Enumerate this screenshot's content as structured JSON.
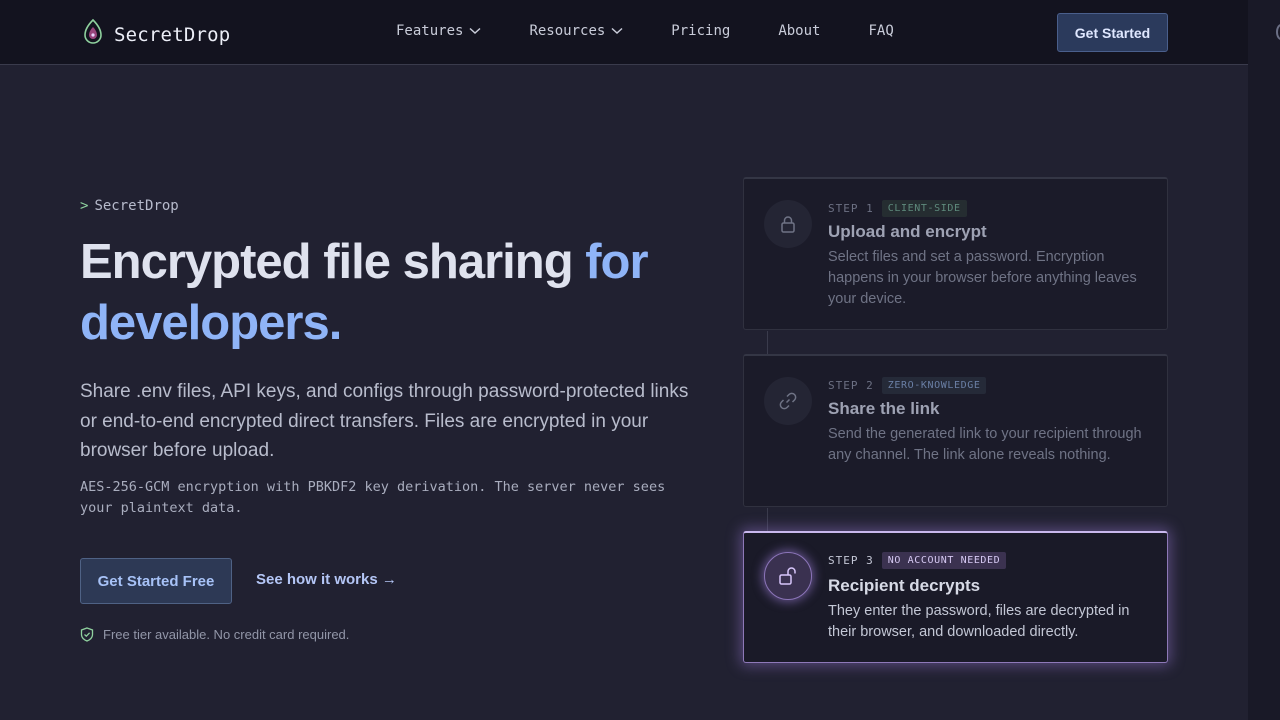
{
  "header": {
    "brand": "SecretDrop",
    "nav": [
      {
        "label": "Features",
        "has_dropdown": true
      },
      {
        "label": "Resources",
        "has_dropdown": true
      },
      {
        "label": "Pricing",
        "has_dropdown": false
      },
      {
        "label": "About",
        "has_dropdown": false
      },
      {
        "label": "FAQ",
        "has_dropdown": false
      }
    ],
    "cta": "Get Started"
  },
  "hero": {
    "eyebrow_prompt": ">",
    "eyebrow": "SecretDrop",
    "headline_main": "Encrypted file sharing ",
    "headline_accent": "for developers.",
    "lede": "Share .env files, API keys, and configs through password-protected links or end-to-end encrypted direct transfers. Files are encrypted in your browser before upload.",
    "tech_note": "AES-256-GCM encryption with PBKDF2 key derivation. The server never sees your plaintext data.",
    "primary_cta": "Get Started Free",
    "secondary_cta": "See how it works →",
    "footnote": "Free tier available. No credit card required."
  },
  "steps": [
    {
      "label": "STEP 1",
      "badge": "CLIENT-SIDE",
      "title": "Upload and encrypt",
      "description": "Select files and set a password. Encryption happens in your browser before anything leaves your device.",
      "icon": "lock-icon"
    },
    {
      "label": "STEP 2",
      "badge": "ZERO-KNOWLEDGE",
      "title": "Share the link",
      "description": "Send the generated link to your recipient through any channel. The link alone reveals nothing.",
      "icon": "link-icon"
    },
    {
      "label": "STEP 3",
      "badge": "NO ACCOUNT NEEDED",
      "title": "Recipient decrypts",
      "description": "They enter the password, files are decrypted in their browser, and downloaded directly.",
      "icon": "unlock-icon",
      "active": true
    }
  ],
  "colors": {
    "accent": "#8fb4f7",
    "active_glow": "#c9b8ee",
    "success": "#8fd19e"
  }
}
